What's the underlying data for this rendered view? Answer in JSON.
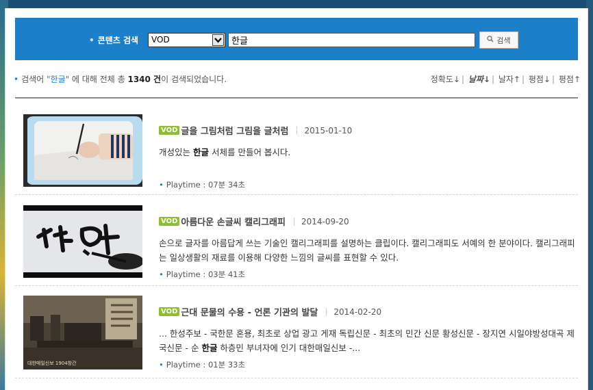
{
  "search": {
    "label": "콘텐츠 검색",
    "select_value": "VOD",
    "query": "한글",
    "button_label": "검색"
  },
  "summary": {
    "prefix": "검색어 ",
    "keyword": "\"한글\"",
    "middle": " 에 대해 전체 총 ",
    "count": "1340 건",
    "suffix": "이 검색되었습니다."
  },
  "sort": {
    "accuracy": "정확도↓",
    "date_desc": "날짜↓",
    "date_asc": "날자↑",
    "rating_desc": "평점↓",
    "rating_asc": "평점↑"
  },
  "results": [
    {
      "badge": "VOD",
      "title": "글을 그림처럼 그림을 글처럼",
      "date": "2015-01-10",
      "desc_pre": "개성있는 ",
      "desc_bold": "한글",
      "desc_post": " 서체를 만들어 봅시다.",
      "playtime": "Playtime : 07분 34초"
    },
    {
      "badge": "VOD",
      "title": "아름다운 손글씨 캘리그래피",
      "date": "2014-09-20",
      "desc": "손으로 글자를 아름답게 쓰는 기술인 캘리그래피를 설명하는 클립이다. 캘리그래피도 서예의 한 분야이다. 캘리그래피는 일상생활의 재료를 이용해 다양한 느낌의 글씨를 표현할 수 있다.",
      "playtime": "Playtime : 03분 41초"
    },
    {
      "badge": "VOD",
      "title": "근대 문물의 수용 - 언론 기관의 발달",
      "date": "2014-02-20",
      "desc_pre": "... 한성주보 - 국한문 혼용, 최초로 상업 광고 게재 독립신문 - 최초의 민간 신문 황성신문 - 장지연 시일야방성대곡 제국신문 - 순 ",
      "desc_bold": "한글",
      "desc_post": " 하층민 부녀자에 인기 대한매일신보 -...",
      "playtime": "Playtime : 01분 33초",
      "thumb_caption": "대한매일신보 1904창간"
    }
  ]
}
